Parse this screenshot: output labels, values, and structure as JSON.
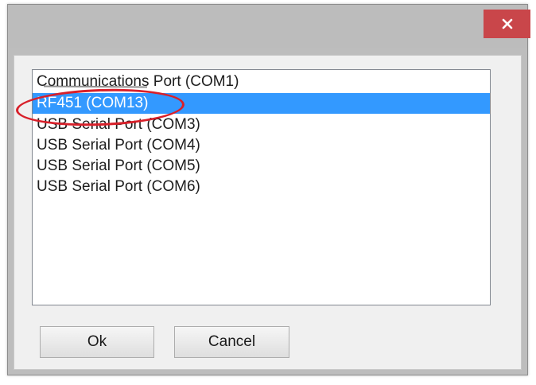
{
  "window": {
    "title": ""
  },
  "titlebar": {
    "close_icon": "close-icon"
  },
  "port_list": {
    "items": [
      {
        "label": "Communications Port (COM1)"
      },
      {
        "label": "RF451 (COM13)"
      },
      {
        "label": "USB Serial Port (COM3)"
      },
      {
        "label": "USB Serial Port (COM4)"
      },
      {
        "label": "USB Serial Port (COM5)"
      },
      {
        "label": "USB Serial Port (COM6)"
      }
    ],
    "selected_label": "RF451 (COM13)"
  },
  "buttons": {
    "ok_label": "Ok",
    "cancel_label": "Cancel"
  },
  "colors": {
    "close_button": "#c9464a",
    "selection": "#3399ff",
    "annotation": "#d8202a"
  }
}
